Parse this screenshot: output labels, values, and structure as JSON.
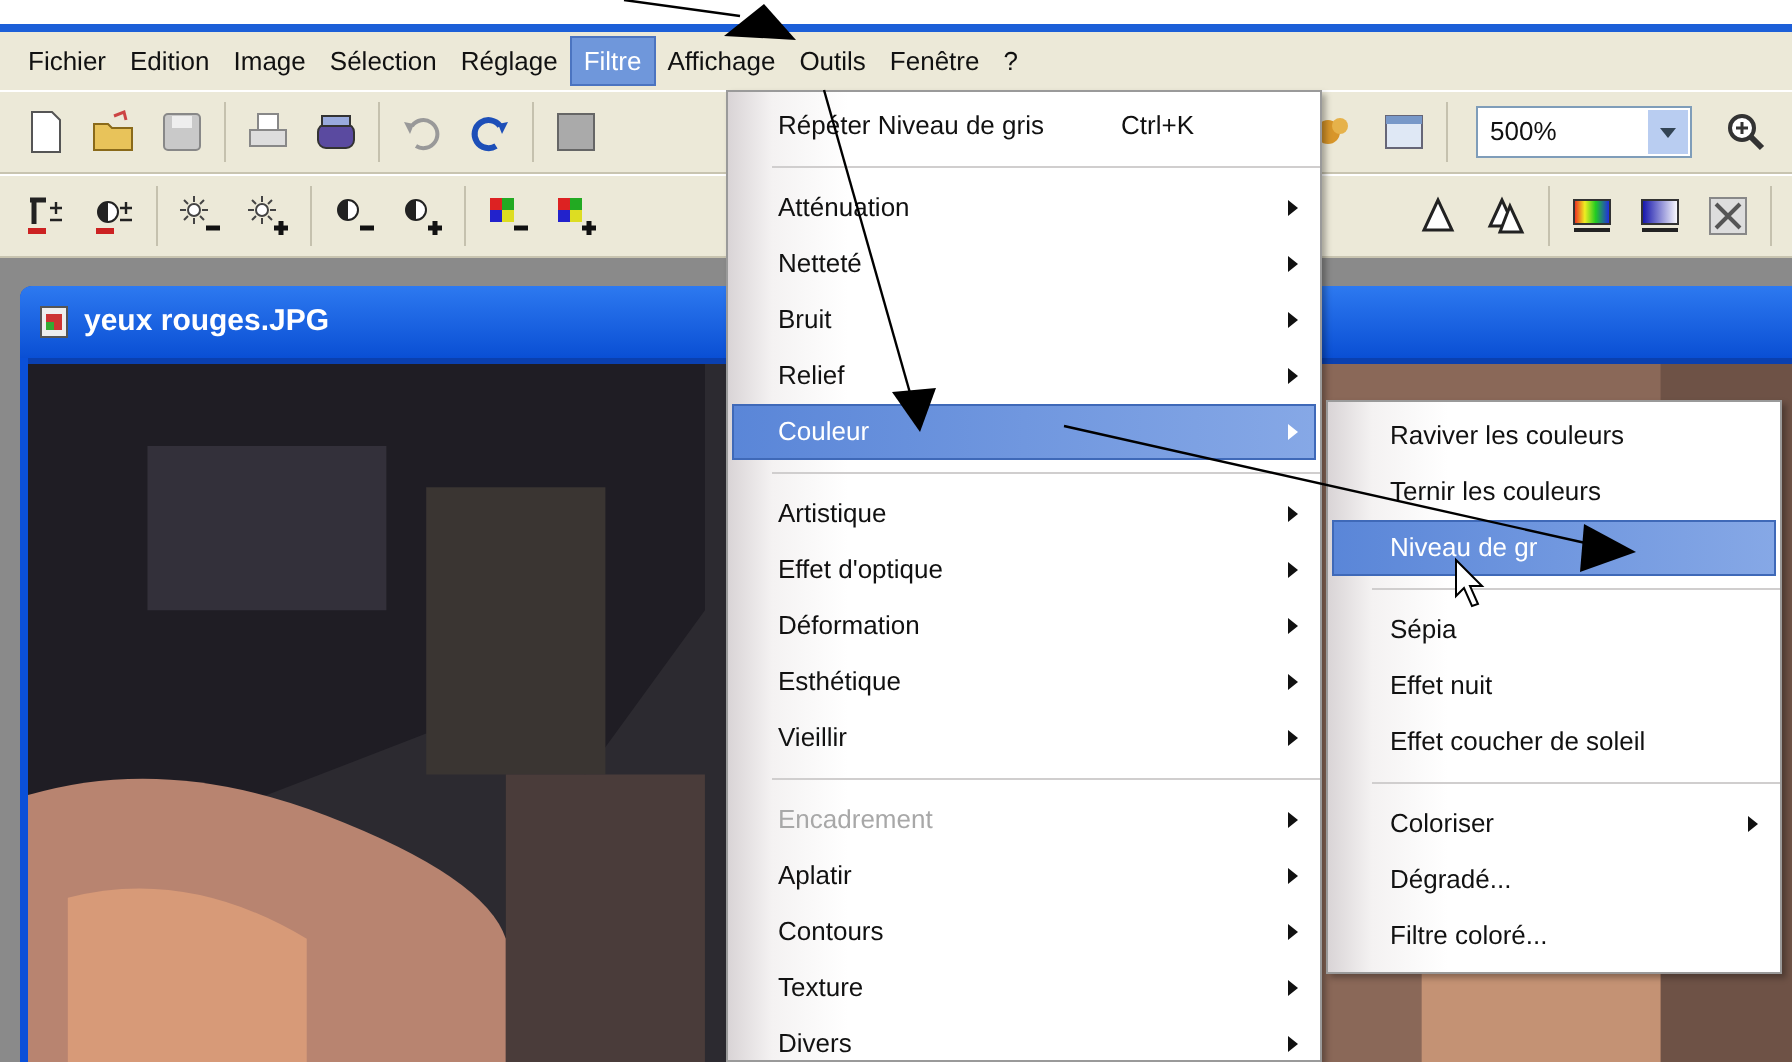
{
  "menubar": [
    {
      "label": "Fichier",
      "selected": false
    },
    {
      "label": "Edition",
      "selected": false
    },
    {
      "label": "Image",
      "selected": false
    },
    {
      "label": "Sélection",
      "selected": false
    },
    {
      "label": "Réglage",
      "selected": false
    },
    {
      "label": "Filtre",
      "selected": true
    },
    {
      "label": "Affichage",
      "selected": false
    },
    {
      "label": "Outils",
      "selected": false
    },
    {
      "label": "Fenêtre",
      "selected": false
    },
    {
      "label": "?",
      "selected": false
    }
  ],
  "zoom_combo": {
    "value": "500%"
  },
  "document": {
    "title": "yeux rouges.JPG",
    "kind": "picture"
  },
  "filter_menu": {
    "items": [
      {
        "kind": "item",
        "label": "Répéter Niveau de gris",
        "shortcut": "Ctrl+K",
        "submenu": false,
        "selected": false,
        "disabled": false
      },
      {
        "kind": "separator"
      },
      {
        "kind": "item",
        "label": "Atténuation",
        "submenu": true,
        "selected": false,
        "disabled": false
      },
      {
        "kind": "item",
        "label": "Netteté",
        "submenu": true,
        "selected": false,
        "disabled": false
      },
      {
        "kind": "item",
        "label": "Bruit",
        "submenu": true,
        "selected": false,
        "disabled": false
      },
      {
        "kind": "item",
        "label": "Relief",
        "submenu": true,
        "selected": false,
        "disabled": false
      },
      {
        "kind": "item",
        "label": "Couleur",
        "submenu": true,
        "selected": true,
        "disabled": false
      },
      {
        "kind": "separator"
      },
      {
        "kind": "item",
        "label": "Artistique",
        "submenu": true,
        "selected": false,
        "disabled": false
      },
      {
        "kind": "item",
        "label": "Effet d'optique",
        "submenu": true,
        "selected": false,
        "disabled": false
      },
      {
        "kind": "item",
        "label": "Déformation",
        "submenu": true,
        "selected": false,
        "disabled": false
      },
      {
        "kind": "item",
        "label": "Esthétique",
        "submenu": true,
        "selected": false,
        "disabled": false
      },
      {
        "kind": "item",
        "label": "Vieillir",
        "submenu": true,
        "selected": false,
        "disabled": false
      },
      {
        "kind": "separator"
      },
      {
        "kind": "item",
        "label": "Encadrement",
        "submenu": true,
        "selected": false,
        "disabled": true
      },
      {
        "kind": "item",
        "label": "Aplatir",
        "submenu": true,
        "selected": false,
        "disabled": false
      },
      {
        "kind": "item",
        "label": "Contours",
        "submenu": true,
        "selected": false,
        "disabled": false
      },
      {
        "kind": "item",
        "label": "Texture",
        "submenu": true,
        "selected": false,
        "disabled": false
      },
      {
        "kind": "item",
        "label": "Divers",
        "submenu": true,
        "selected": false,
        "disabled": false
      }
    ]
  },
  "color_submenu": {
    "items": [
      {
        "kind": "item",
        "label": "Raviver les couleurs",
        "submenu": false,
        "selected": false,
        "disabled": false
      },
      {
        "kind": "item",
        "label": "Ternir les couleurs",
        "submenu": false,
        "selected": false,
        "disabled": false
      },
      {
        "kind": "item",
        "label": "Niveau de gr",
        "submenu": false,
        "selected": true,
        "disabled": false
      },
      {
        "kind": "separator"
      },
      {
        "kind": "item",
        "label": "Sépia",
        "submenu": false,
        "selected": false,
        "disabled": false
      },
      {
        "kind": "item",
        "label": "Effet nuit",
        "submenu": false,
        "selected": false,
        "disabled": false
      },
      {
        "kind": "item",
        "label": "Effet coucher de soleil",
        "submenu": false,
        "selected": false,
        "disabled": false
      },
      {
        "kind": "separator"
      },
      {
        "kind": "item",
        "label": "Coloriser",
        "submenu": true,
        "selected": false,
        "disabled": false
      },
      {
        "kind": "item",
        "label": "Dégradé...",
        "submenu": false,
        "selected": false,
        "disabled": false
      },
      {
        "kind": "item",
        "label": "Filtre coloré...",
        "submenu": false,
        "selected": false,
        "disabled": false
      }
    ]
  }
}
